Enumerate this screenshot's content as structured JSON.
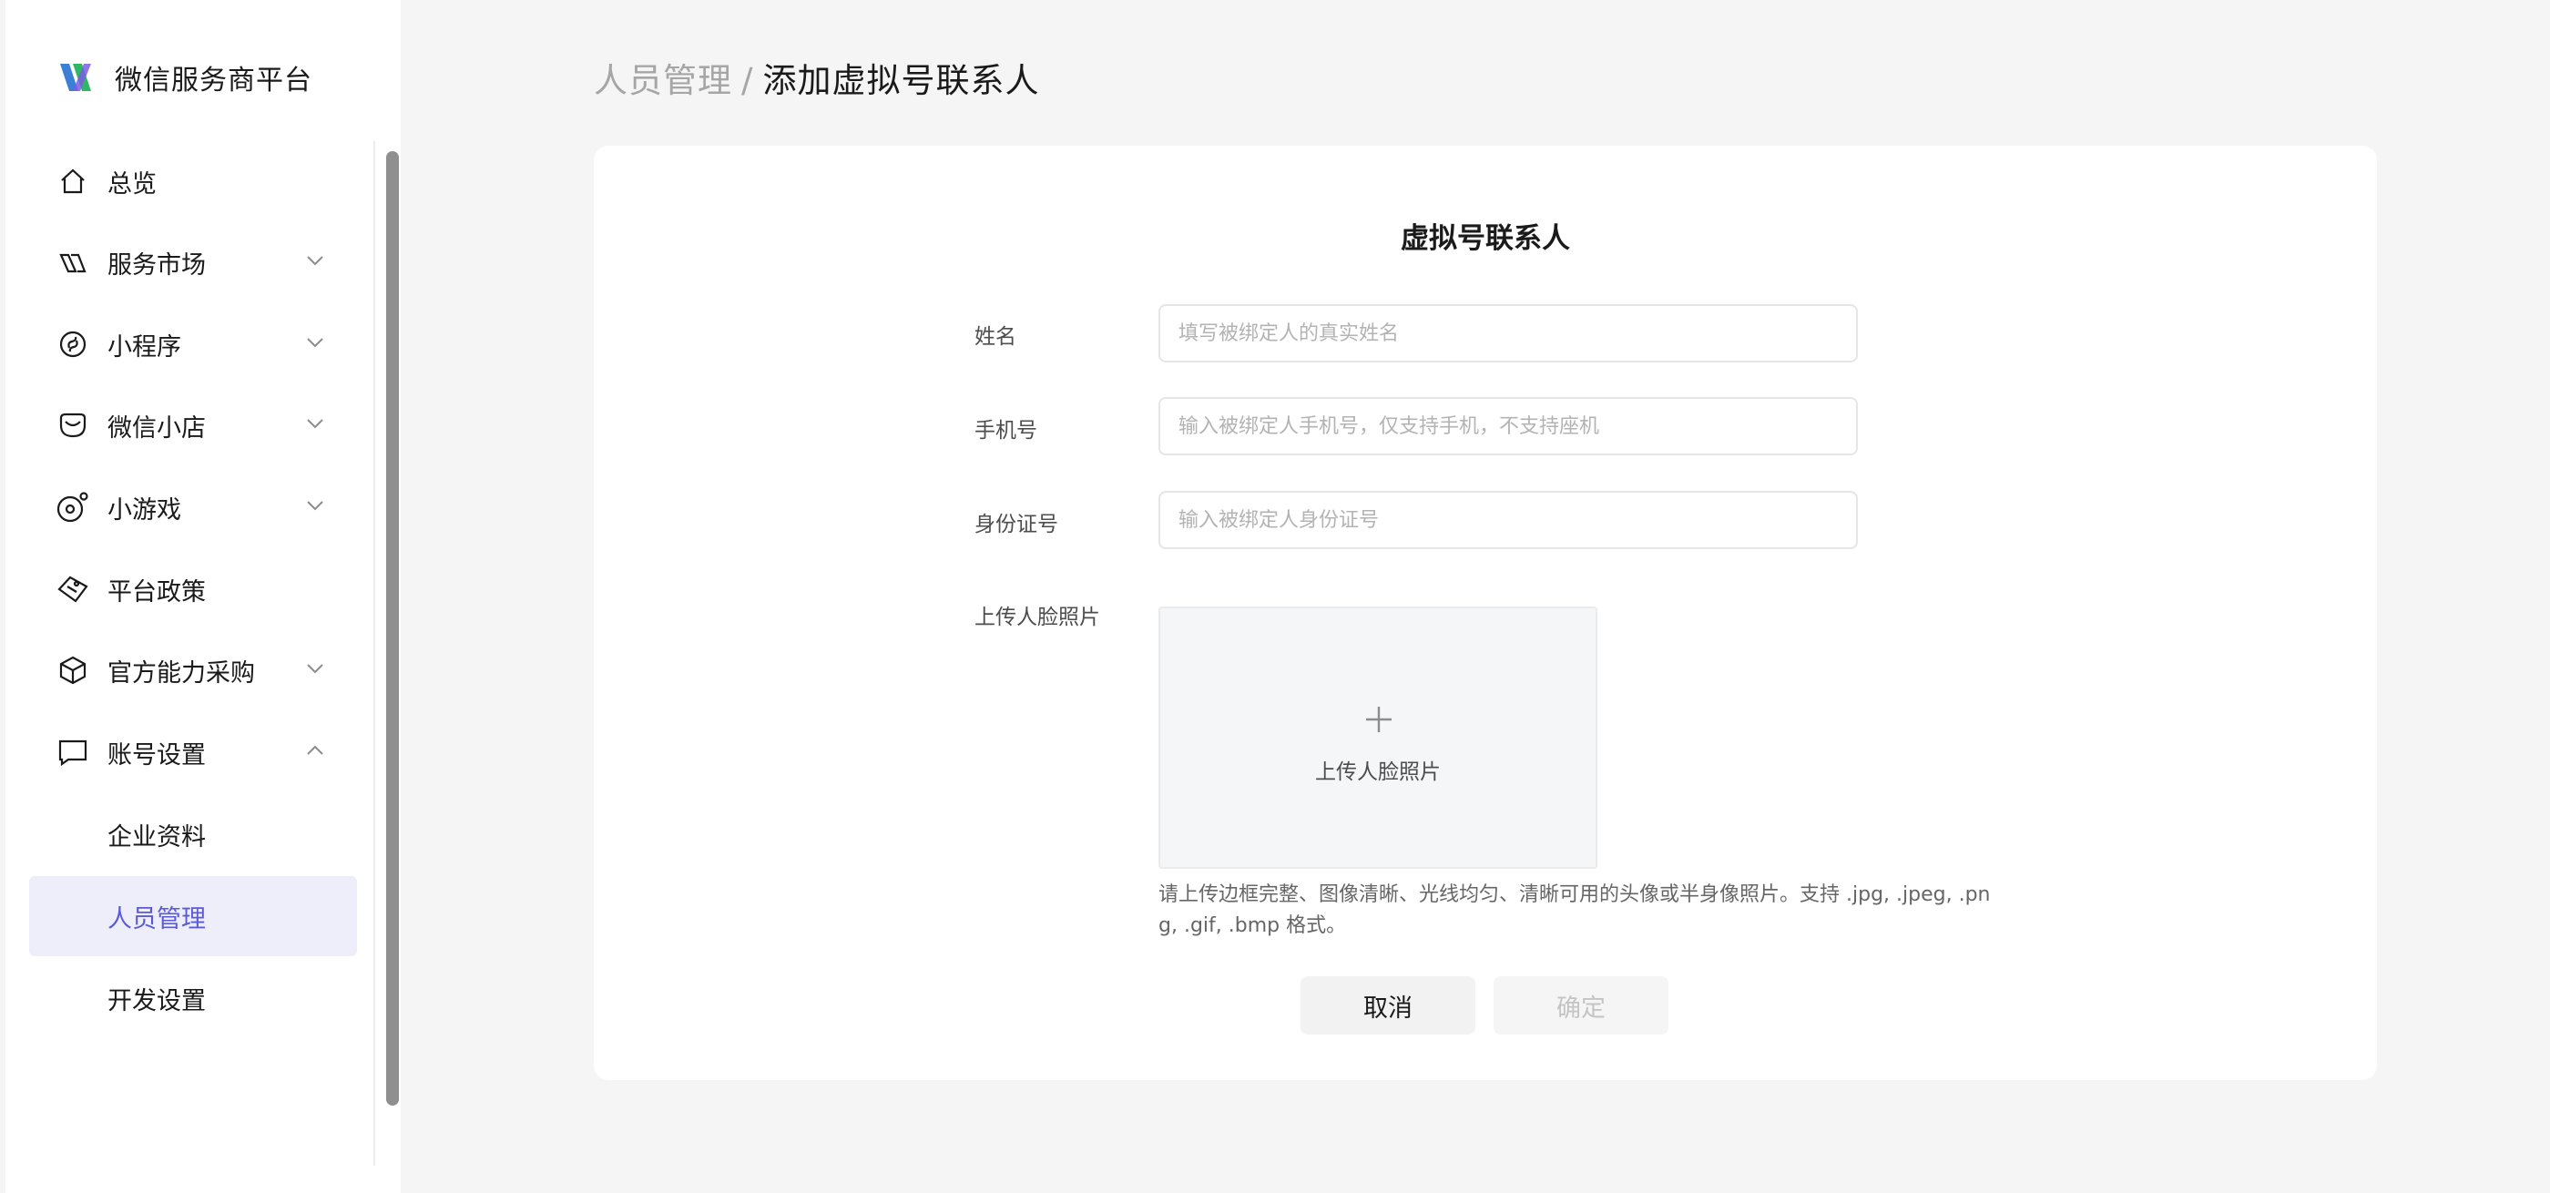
{
  "brand": {
    "name": "微信服务商平台"
  },
  "sidebar": {
    "items": [
      {
        "label": "总览",
        "icon": "home-icon",
        "chevron": ""
      },
      {
        "label": "服务市场",
        "icon": "service-market-icon",
        "chevron": "down"
      },
      {
        "label": "小程序",
        "icon": "mini-program-icon",
        "chevron": "down"
      },
      {
        "label": "微信小店",
        "icon": "shop-icon",
        "chevron": "down"
      },
      {
        "label": "小游戏",
        "icon": "game-icon",
        "chevron": "down"
      },
      {
        "label": "平台政策",
        "icon": "policy-icon",
        "chevron": ""
      },
      {
        "label": "官方能力采购",
        "icon": "cube-icon",
        "chevron": "down"
      },
      {
        "label": "账号设置",
        "icon": "chat-icon",
        "chevron": "up"
      }
    ],
    "sub_items": [
      {
        "label": "企业资料",
        "active": false
      },
      {
        "label": "人员管理",
        "active": true
      },
      {
        "label": "开发设置",
        "active": false
      }
    ]
  },
  "breadcrumb": {
    "parent": "人员管理",
    "separator": "/",
    "current": "添加虚拟号联系人"
  },
  "form": {
    "title": "虚拟号联系人",
    "name": {
      "label": "姓名",
      "value": "",
      "placeholder": "填写被绑定人的真实姓名"
    },
    "phone": {
      "label": "手机号",
      "value": "",
      "placeholder": "输入被绑定人手机号，仅支持手机，不支持座机"
    },
    "id_card": {
      "label": "身份证号",
      "value": "",
      "placeholder": "输入被绑定人身份证号"
    },
    "photo": {
      "label": "上传人脸照片",
      "upload_text": "上传人脸照片",
      "hint": "请上传边框完整、图像清晰、光线均匀、清晰可用的头像或半身像照片。支持 .jpg, .jpeg, .png, .gif, .bmp 格式。"
    },
    "cancel_label": "取消",
    "confirm_label": "确定"
  },
  "colors": {
    "accent": "#5b5bd6",
    "active_bg": "#eeeefa",
    "page_bg": "#f5f5f5"
  }
}
